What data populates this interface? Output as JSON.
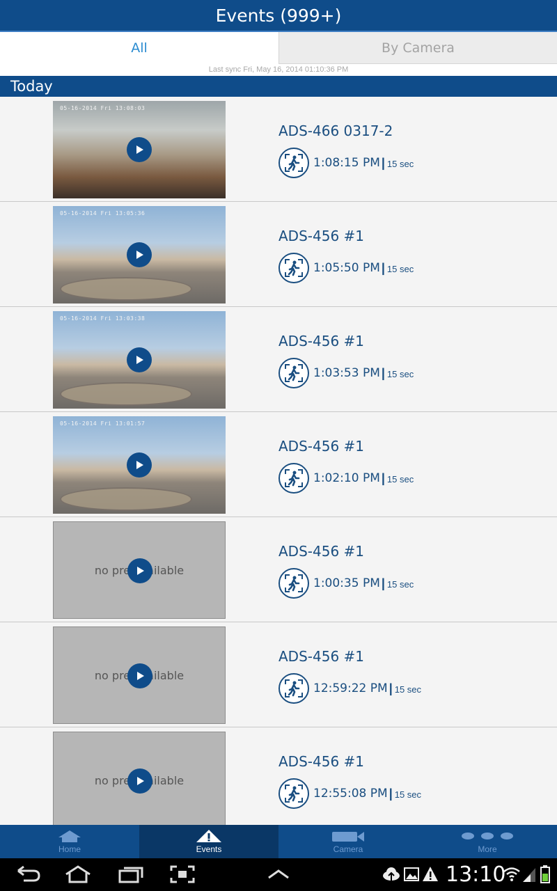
{
  "header": {
    "title": "Events (999+)"
  },
  "tabs": [
    {
      "label": "All",
      "active": true
    },
    {
      "label": "By Camera",
      "active": false
    }
  ],
  "sync_text": "Last sync Fri, May 16, 2014 01:10:36 PM",
  "section_title": "Today",
  "events": [
    {
      "camera": "ADS-466 0317-2",
      "time": "1:08:15 PM",
      "duration": "15 sec",
      "preview": "office",
      "stamp": "05-16-2014 Fri 13:08:03"
    },
    {
      "camera": "ADS-456 #1",
      "time": "1:05:50 PM",
      "duration": "15 sec",
      "preview": "street",
      "stamp": "05-16-2014 Fri 13:05:36"
    },
    {
      "camera": "ADS-456 #1",
      "time": "1:03:53 PM",
      "duration": "15 sec",
      "preview": "street",
      "stamp": "05-16-2014 Fri 13:03:38"
    },
    {
      "camera": "ADS-456 #1",
      "time": "1:02:10 PM",
      "duration": "15 sec",
      "preview": "street",
      "stamp": "05-16-2014 Fri 13:01:57"
    },
    {
      "camera": "ADS-456 #1",
      "time": "1:00:35 PM",
      "duration": "15 sec",
      "preview": "none",
      "no_preview_text": "no prev   vailable"
    },
    {
      "camera": "ADS-456 #1",
      "time": "12:59:22 PM",
      "duration": "15 sec",
      "preview": "none",
      "no_preview_text": "no prev   vailable"
    },
    {
      "camera": "ADS-456 #1",
      "time": "12:55:08 PM",
      "duration": "15 sec",
      "preview": "none",
      "no_preview_text": "no prev   vailable"
    }
  ],
  "bottom_nav": [
    {
      "label": "Home",
      "icon": "home-icon",
      "active": false
    },
    {
      "label": "Events",
      "icon": "warning-icon",
      "active": true
    },
    {
      "label": "Camera",
      "icon": "camera-icon",
      "active": false
    },
    {
      "label": "More",
      "icon": "more-icon",
      "active": false
    }
  ],
  "status_bar": {
    "clock": "13:10"
  },
  "colors": {
    "brand": "#0f4c8a",
    "tab_active_text": "#2a8bd0",
    "text_dark_blue": "#1a4e80"
  }
}
